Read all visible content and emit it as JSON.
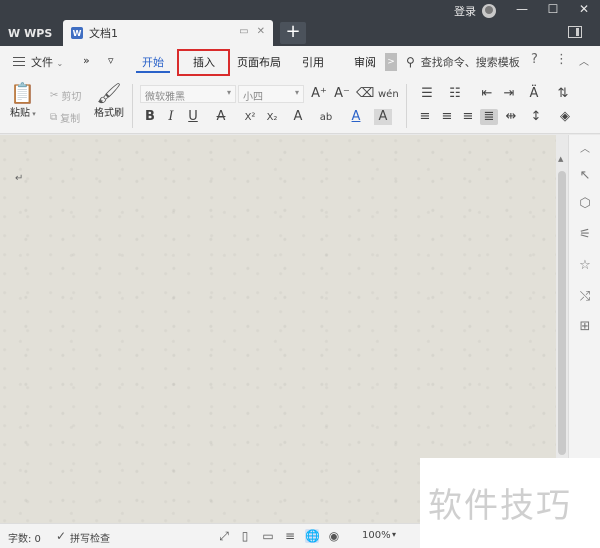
{
  "titlebar": {
    "app_name": "WPS",
    "doc_tab": "文档1",
    "new_tab": "+",
    "login": "登录",
    "minimize": "—",
    "maximize": "☐",
    "close": "✕"
  },
  "menubar": {
    "file_menu": "文件",
    "more": "»",
    "dropdown": "▿",
    "tabs": [
      "开始",
      "插入",
      "页面布局",
      "引用",
      "审阅"
    ],
    "active_tab": "开始",
    "highlighted_tab": "插入",
    "scroll_right": ">",
    "search_placeholder": "查找命令、搜索模板",
    "help": "?",
    "more_options": "⋮",
    "collapse": "︿"
  },
  "ribbon": {
    "paste": "粘贴",
    "cut": "剪切",
    "copy": "复制",
    "format_painter": "格式刷",
    "font_name": "微软雅黑",
    "font_size": "小四"
  },
  "statusbar": {
    "word_count": "字数: 0",
    "spell_check": "拼写检查",
    "zoom": "100%"
  },
  "watermark": "软件技巧",
  "colors": {
    "accent": "#2a62c9",
    "highlight_border": "#d92b2b",
    "titlebar_bg": "#3a3f46",
    "paper": "#e2e0d8"
  }
}
